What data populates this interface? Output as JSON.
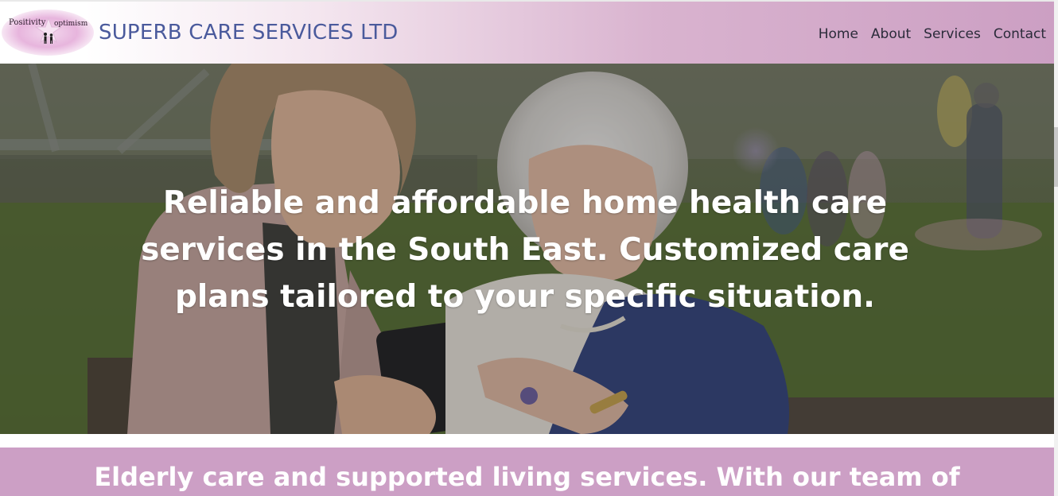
{
  "header": {
    "logo": {
      "text_left": "Positivity",
      "text_right": "optimism"
    },
    "title": "SUPERB CARE SERVICES LTD",
    "nav": [
      {
        "label": "Home"
      },
      {
        "label": "About"
      },
      {
        "label": "Services"
      },
      {
        "label": "Contact"
      }
    ]
  },
  "hero": {
    "headline": "Reliable and affordable home health care services in the South East. Customized care plans tailored to your specific situation."
  },
  "band": {
    "text": "Elderly care and supported living services. With our team of"
  },
  "colors": {
    "title": "#4a5a9c",
    "header_gradient_end": "#cc9fc3",
    "band": "#cc9fc5",
    "hero_text": "#ffffff"
  }
}
